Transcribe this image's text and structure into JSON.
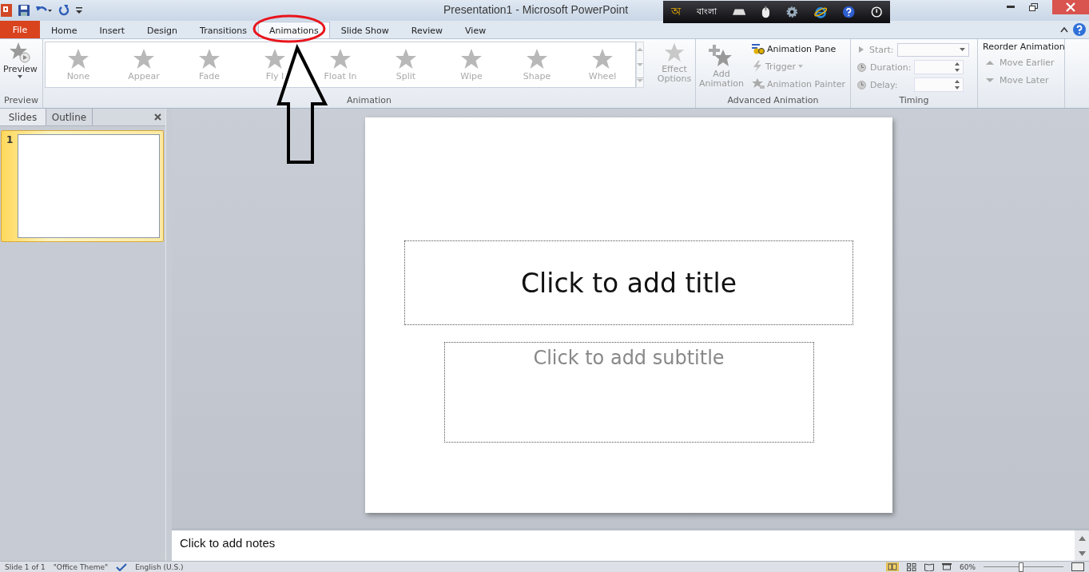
{
  "app": {
    "title": "Presentation1  -  Microsoft PowerPoint"
  },
  "language_bar": {
    "script_label": "অ",
    "language": "বাংলা"
  },
  "tabs": [
    {
      "label": "File",
      "kind": "file",
      "selected": false
    },
    {
      "label": "Home",
      "kind": "tab",
      "selected": false
    },
    {
      "label": "Insert",
      "kind": "tab",
      "selected": false
    },
    {
      "label": "Design",
      "kind": "tab",
      "selected": false
    },
    {
      "label": "Transitions",
      "kind": "tab",
      "selected": false
    },
    {
      "label": "Animations",
      "kind": "tab",
      "selected": true
    },
    {
      "label": "Slide Show",
      "kind": "tab",
      "selected": false
    },
    {
      "label": "Review",
      "kind": "tab",
      "selected": false
    },
    {
      "label": "View",
      "kind": "tab",
      "selected": false
    }
  ],
  "ribbon": {
    "preview": {
      "label": "Preview",
      "group": "Preview"
    },
    "animation_gallery": {
      "group": "Animation",
      "items": [
        {
          "label": "None",
          "disabled": true
        },
        {
          "label": "Appear",
          "disabled": true
        },
        {
          "label": "Fade",
          "disabled": true
        },
        {
          "label": "Fly I",
          "disabled": true
        },
        {
          "label": "Float In",
          "disabled": true
        },
        {
          "label": "Split",
          "disabled": true
        },
        {
          "label": "Wipe",
          "disabled": true
        },
        {
          "label": "Shape",
          "disabled": true
        },
        {
          "label": "Wheel",
          "disabled": true
        }
      ]
    },
    "effect_options": {
      "label": "Effect Options",
      "disabled": true
    },
    "advanced": {
      "group": "Advanced Animation",
      "add_animation": "Add Animation",
      "items": [
        {
          "label": "Animation Pane",
          "disabled": false
        },
        {
          "label": "Trigger",
          "disabled": true
        },
        {
          "label": "Animation Painter",
          "disabled": true
        }
      ]
    },
    "timing": {
      "group": "Timing",
      "fields": [
        {
          "label": "Start:",
          "kind": "dropdown"
        },
        {
          "label": "Duration:",
          "kind": "spinner"
        },
        {
          "label": "Delay:",
          "kind": "spinner"
        }
      ]
    },
    "reorder": {
      "title": "Reorder Animation",
      "items": [
        {
          "label": "Move Earlier",
          "disabled": true
        },
        {
          "label": "Move Later",
          "disabled": true
        }
      ]
    }
  },
  "side_panel": {
    "tabs": [
      {
        "label": "Slides",
        "selected": true
      },
      {
        "label": "Outline",
        "selected": false
      }
    ],
    "slides": [
      {
        "number": "1",
        "selected": true
      }
    ]
  },
  "slide": {
    "title_placeholder": "Click to add title",
    "subtitle_placeholder": "Click to add subtitle"
  },
  "notes": {
    "placeholder": "Click to add notes"
  },
  "status_bar": {
    "slide": "Slide 1 of 1",
    "theme": "\"Office Theme\"",
    "language": "English (U.S.)",
    "zoom": "60%",
    "zoom_slider": {
      "level": 0.46
    }
  },
  "annotations": {
    "highlight_ellipse": true,
    "arrow": true
  }
}
